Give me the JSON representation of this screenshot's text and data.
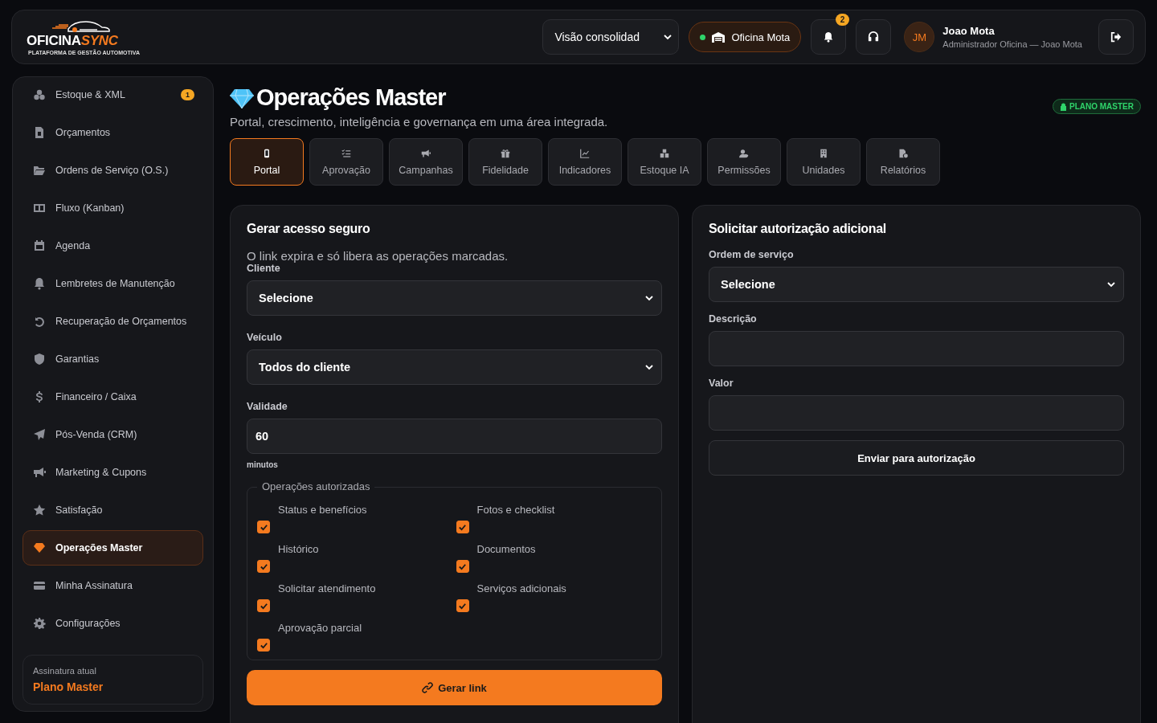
{
  "header": {
    "logo": {
      "name_start": "OFICINA",
      "name_end": "SYNC",
      "tagline": "PLATAFORMA DE GESTÃO AUTOMOTIVA"
    },
    "view_select": {
      "value": "Visão consolidad"
    },
    "shop_chip": {
      "label": "Oficina Mota",
      "online": true
    },
    "notifications": {
      "count": "2"
    },
    "user": {
      "initials": "JM",
      "name": "Joao Mota",
      "role": "Administrador Oficina — Joao Mota"
    }
  },
  "sidebar": {
    "items": [
      {
        "label": "Estoque & XML",
        "badge": "1",
        "selected": false
      },
      {
        "label": "Orçamentos",
        "selected": false
      },
      {
        "label": "Ordens de Serviço (O.S.)",
        "selected": false
      },
      {
        "label": "Fluxo (Kanban)",
        "selected": false
      },
      {
        "label": "Agenda",
        "selected": false
      },
      {
        "label": "Lembretes de Manutenção",
        "selected": false
      },
      {
        "label": "Recuperação de Orçamentos",
        "selected": false
      },
      {
        "label": "Garantias",
        "selected": false
      },
      {
        "label": "Financeiro / Caixa",
        "selected": false
      },
      {
        "label": "Pós-Venda (CRM)",
        "selected": false
      },
      {
        "label": "Marketing & Cupons",
        "selected": false
      },
      {
        "label": "Satisfação",
        "selected": false
      },
      {
        "label": "Operações Master",
        "selected": true
      },
      {
        "label": "Minha Assinatura",
        "selected": false
      },
      {
        "label": "Configurações",
        "selected": false
      }
    ],
    "subscription": {
      "label": "Assinatura atual",
      "plan": "Plano Master"
    }
  },
  "page": {
    "title": "Operações Master",
    "subtitle": "Portal, crescimento, inteligência e governança em uma área integrada.",
    "plan_badge": "PLANO MASTER",
    "tabs": [
      {
        "label": "Portal",
        "selected": true
      },
      {
        "label": "Aprovação",
        "selected": false
      },
      {
        "label": "Campanhas",
        "selected": false
      },
      {
        "label": "Fidelidade",
        "selected": false
      },
      {
        "label": "Indicadores",
        "selected": false
      },
      {
        "label": "Estoque IA",
        "selected": false
      },
      {
        "label": "Permissões",
        "selected": false
      },
      {
        "label": "Unidades",
        "selected": false
      },
      {
        "label": "Relatórios",
        "selected": false
      }
    ]
  },
  "access_card": {
    "title": "Gerar acesso seguro",
    "hint": "O link expira e só libera as operações marcadas.",
    "client": {
      "label": "Cliente",
      "value": "Selecione"
    },
    "vehicle": {
      "label": "Veículo",
      "value": "Todos do cliente"
    },
    "validity": {
      "label": "Validade",
      "value": "60",
      "unit": "minutos"
    },
    "operations_legend": "Operações autorizadas",
    "operations": [
      {
        "label": "Status e benefícios",
        "checked": true
      },
      {
        "label": "Fotos e checklist",
        "checked": true
      },
      {
        "label": "Histórico",
        "checked": true
      },
      {
        "label": "Documentos",
        "checked": true
      },
      {
        "label": "Solicitar atendimento",
        "checked": true
      },
      {
        "label": "Serviços adicionais",
        "checked": true
      },
      {
        "label": "Aprovação parcial",
        "checked": true
      }
    ],
    "button": "Gerar link"
  },
  "authorization_card": {
    "title": "Solicitar autorização adicional",
    "order": {
      "label": "Ordem de serviço",
      "value": "Selecione"
    },
    "description": {
      "label": "Descrição"
    },
    "amount": {
      "label": "Valor"
    },
    "button": "Enviar para autorização"
  }
}
